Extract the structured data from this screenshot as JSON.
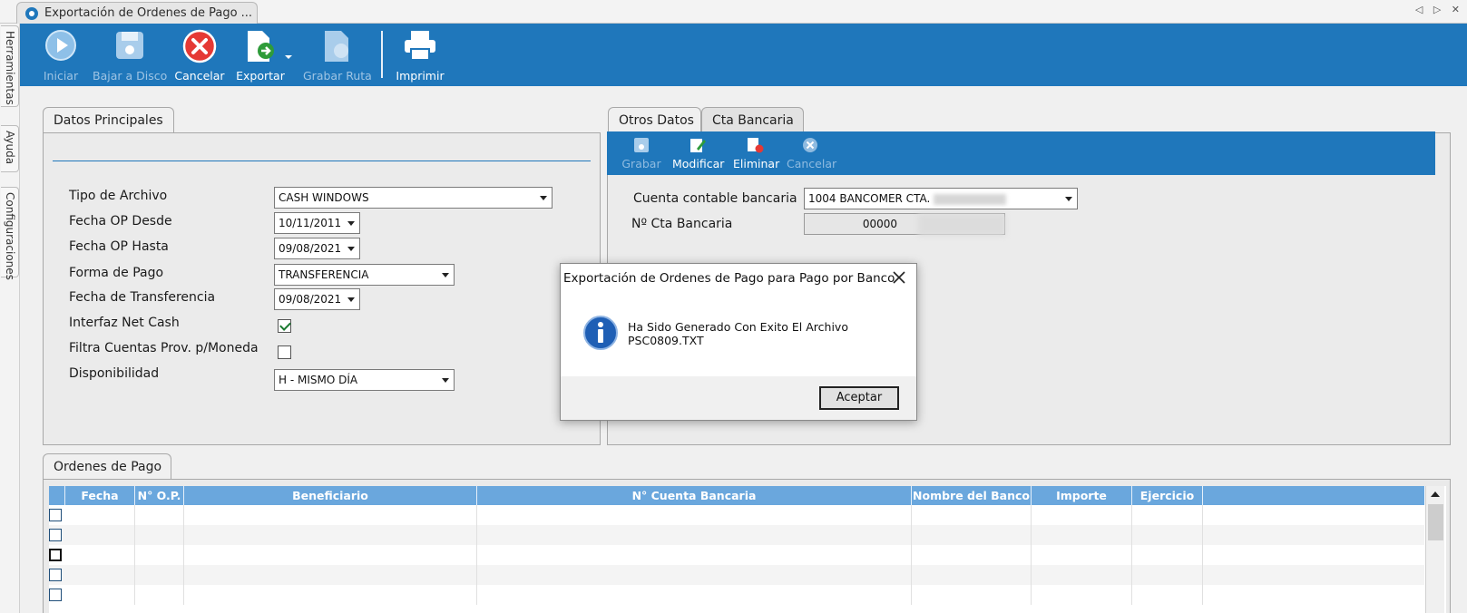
{
  "window": {
    "tab_title": "Exportación de Ordenes de Pago ...",
    "nav_arrows": "◁ ▷ ✕"
  },
  "sidetabs": [
    "Herramientas",
    "Ayuda",
    "Configuraciones"
  ],
  "ribbon": {
    "iniciar": "Iniciar",
    "bajar_disco": "Bajar a Disco",
    "cancelar": "Cancelar",
    "exportar": "Exportar",
    "grabar_ruta": "Grabar Ruta",
    "imprimir": "Imprimir"
  },
  "datos": {
    "tab": "Datos Principales",
    "tipo_archivo_label": "Tipo de Archivo",
    "tipo_archivo_value": "CASH WINDOWS",
    "fecha_desde_label": "Fecha OP Desde",
    "fecha_desde_value": "10/11/2011",
    "fecha_hasta_label": "Fecha OP Hasta",
    "fecha_hasta_value": "09/08/2021",
    "forma_pago_label": "Forma de Pago",
    "forma_pago_value": "TRANSFERENCIA",
    "fecha_transf_label": "Fecha de Transferencia",
    "fecha_transf_value": "09/08/2021",
    "interfaz_label": "Interfaz Net Cash",
    "interfaz_checked": true,
    "filtra_label": "Filtra Cuentas Prov. p/Moneda",
    "filtra_checked": false,
    "disponibilidad_label": "Disponibilidad",
    "disponibilidad_value": "H - MISMO DÍA"
  },
  "otros": {
    "tab_otros": "Otros Datos",
    "tab_cta": "Cta Bancaria",
    "grabar": "Grabar",
    "modificar": "Modificar",
    "eliminar": "Eliminar",
    "cancelar": "Cancelar",
    "cuenta_label": "Cuenta contable bancaria",
    "cuenta_value": "1004  BANCOMER CTA.",
    "nro_label": "Nº Cta Bancaria",
    "nro_value": "00000"
  },
  "ordenes": {
    "tab": "Ordenes de Pago",
    "columns": [
      "Fecha",
      "N° O.P.",
      "Beneficiario",
      "N° Cuenta Bancaria",
      "Nombre del Banco",
      "Importe",
      "Ejercicio"
    ]
  },
  "dialog": {
    "title": "Exportación de Ordenes de Pago para Pago por Banco",
    "line1": "Ha Sido Generado Con Exito El Archivo",
    "line2": "PSC0809.TXT",
    "ok": "Aceptar"
  }
}
